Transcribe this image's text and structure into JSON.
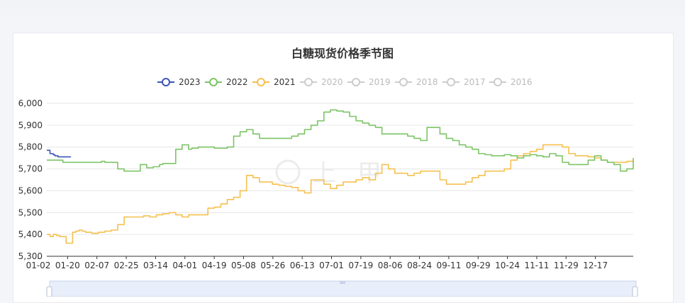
{
  "chart_data": {
    "type": "line",
    "title": "白糖现货价格季节图",
    "xlabel": "",
    "ylabel": "",
    "ylim": [
      5300,
      6000
    ],
    "yticks": [
      "6,000",
      "5,900",
      "5,800",
      "5,700",
      "5,600",
      "5,500",
      "5,400",
      "5,300"
    ],
    "xticks": [
      "01-02",
      "01-20",
      "02-07",
      "02-25",
      "03-14",
      "04-01",
      "04-19",
      "05-08",
      "05-26",
      "06-13",
      "07-01",
      "07-19",
      "08-06",
      "08-24",
      "09-11",
      "09-29",
      "10-24",
      "11-11",
      "11-29",
      "12-17"
    ],
    "grid": true,
    "legend_position": "top",
    "watermark": "上甲",
    "series": [
      {
        "name": "2023",
        "color": "#3b55b6",
        "active": true,
        "x": [
          0,
          1,
          2,
          4,
          5,
          7,
          8,
          9,
          11,
          12,
          13,
          14,
          15
        ],
        "y": [
          5785,
          5785,
          5770,
          5765,
          5760,
          5755,
          5755,
          5755,
          5755,
          5755,
          5755,
          5755,
          5755
        ]
      },
      {
        "name": "2022",
        "color": "#7cc466",
        "active": true,
        "x": [
          0,
          4,
          10,
          16,
          20,
          24,
          28,
          30,
          34,
          36,
          40,
          44,
          48,
          52,
          56,
          58,
          62,
          66,
          70,
          72,
          76,
          80,
          84,
          88,
          90,
          94,
          98,
          100,
          104,
          108,
          112,
          116,
          120,
          124,
          128,
          132,
          136,
          140,
          144,
          148,
          152,
          156,
          160,
          164,
          168,
          172,
          176,
          180,
          184,
          188,
          192,
          196,
          200,
          204,
          208,
          212,
          216,
          220,
          224,
          228,
          232,
          236,
          240,
          244,
          248,
          252,
          256,
          260,
          264,
          268,
          272,
          276,
          280,
          284,
          288,
          292,
          296,
          300,
          304,
          308,
          312,
          316,
          320,
          324,
          328,
          332,
          336,
          340,
          344,
          348,
          352,
          356,
          360,
          364
        ],
        "y": [
          5740,
          5740,
          5730,
          5730,
          5730,
          5730,
          5730,
          5730,
          5735,
          5730,
          5730,
          5700,
          5690,
          5690,
          5690,
          5720,
          5705,
          5710,
          5720,
          5725,
          5725,
          5790,
          5810,
          5790,
          5795,
          5800,
          5800,
          5800,
          5795,
          5795,
          5800,
          5850,
          5870,
          5880,
          5860,
          5840,
          5840,
          5840,
          5840,
          5840,
          5850,
          5860,
          5880,
          5900,
          5920,
          5960,
          5970,
          5965,
          5960,
          5940,
          5920,
          5910,
          5900,
          5890,
          5860,
          5860,
          5860,
          5860,
          5850,
          5840,
          5830,
          5890,
          5890,
          5860,
          5840,
          5830,
          5810,
          5800,
          5790,
          5770,
          5765,
          5760,
          5760,
          5765,
          5760,
          5750,
          5760,
          5765,
          5760,
          5755,
          5770,
          5760,
          5730,
          5720,
          5720,
          5720,
          5740,
          5760,
          5740,
          5730,
          5720,
          5690,
          5700,
          5750
        ]
      },
      {
        "name": "2021",
        "color": "#f5c04f",
        "active": true,
        "x": [
          0,
          2,
          4,
          6,
          8,
          12,
          14,
          16,
          18,
          20,
          22,
          24,
          28,
          32,
          36,
          40,
          44,
          48,
          52,
          56,
          60,
          64,
          68,
          72,
          76,
          80,
          84,
          88,
          92,
          96,
          100,
          104,
          108,
          112,
          116,
          120,
          124,
          128,
          132,
          136,
          140,
          144,
          148,
          152,
          156,
          160,
          164,
          168,
          172,
          176,
          180,
          184,
          188,
          192,
          196,
          200,
          204,
          208,
          212,
          216,
          220,
          224,
          228,
          232,
          236,
          240,
          244,
          248,
          252,
          256,
          260,
          264,
          268,
          272,
          276,
          280,
          284,
          288,
          292,
          296,
          300,
          304,
          308,
          312,
          316,
          320,
          324,
          328,
          332,
          336,
          340,
          344,
          348,
          352,
          356,
          360,
          364
        ],
        "y": [
          5400,
          5390,
          5400,
          5395,
          5390,
          5360,
          5360,
          5410,
          5415,
          5420,
          5415,
          5410,
          5405,
          5410,
          5415,
          5420,
          5445,
          5480,
          5480,
          5480,
          5485,
          5480,
          5490,
          5495,
          5500,
          5490,
          5480,
          5490,
          5490,
          5490,
          5520,
          5525,
          5540,
          5560,
          5570,
          5600,
          5670,
          5660,
          5640,
          5640,
          5630,
          5625,
          5620,
          5615,
          5600,
          5590,
          5650,
          5650,
          5630,
          5610,
          5625,
          5640,
          5640,
          5650,
          5660,
          5650,
          5680,
          5720,
          5700,
          5680,
          5680,
          5670,
          5680,
          5690,
          5690,
          5690,
          5650,
          5630,
          5630,
          5630,
          5640,
          5660,
          5670,
          5690,
          5690,
          5690,
          5700,
          5740,
          5760,
          5770,
          5780,
          5790,
          5810,
          5810,
          5810,
          5800,
          5770,
          5760,
          5760,
          5755,
          5750,
          5740,
          5730,
          5730,
          5730,
          5735,
          5730
        ]
      },
      {
        "name": "2020",
        "color": "#cccccc",
        "active": false
      },
      {
        "name": "2019",
        "color": "#cccccc",
        "active": false
      },
      {
        "name": "2018",
        "color": "#cccccc",
        "active": false
      },
      {
        "name": "2017",
        "color": "#cccccc",
        "active": false
      },
      {
        "name": "2016",
        "color": "#cccccc",
        "active": false
      }
    ]
  }
}
